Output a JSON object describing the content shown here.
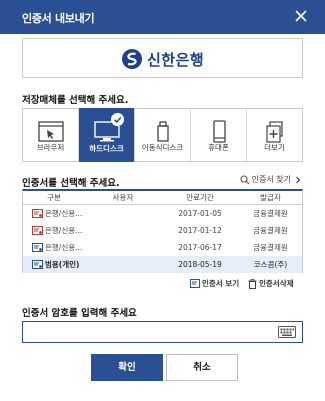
{
  "window": {
    "title": "인증서 내보내기"
  },
  "bank": {
    "name": "신한은행",
    "logo_color": "#1f3f88"
  },
  "media": {
    "heading": "저장매체를 선택해 주세요.",
    "items": [
      {
        "label": "브라우저",
        "icon": "browser-icon",
        "selected": false
      },
      {
        "label": "하드디스크",
        "icon": "hard-disk-icon",
        "selected": true
      },
      {
        "label": "이동식디스크",
        "icon": "removable-disk-icon",
        "selected": false
      },
      {
        "label": "휴대폰",
        "icon": "phone-icon",
        "selected": false
      },
      {
        "label": "더보기",
        "icon": "more-icon",
        "selected": false
      }
    ]
  },
  "certs": {
    "heading": "인증서를 선택해 주세요.",
    "find_label": "인증서 찾기",
    "columns": [
      "구분",
      "사용자",
      "만료기간",
      "발급자"
    ],
    "rows": [
      {
        "type": "은행/신용...",
        "user": "",
        "expiry": "2017-01-05",
        "issuer": "금융결제원",
        "expired": true
      },
      {
        "type": "은행/신용...",
        "user": "",
        "expiry": "2017-01-12",
        "issuer": "금융결제원",
        "expired": true
      },
      {
        "type": "은행/신용...",
        "user": "",
        "expiry": "2017-06-17",
        "issuer": "금융결제원",
        "expired": false
      },
      {
        "type": "범용(개인)",
        "user": "",
        "expiry": "2018-05-19",
        "issuer": "코스콤(주)",
        "expired": false
      }
    ],
    "view_label": "인증서 보기",
    "delete_label": "인증서삭제"
  },
  "password": {
    "heading": "인증서 암호를 입력해 주세요",
    "value": "",
    "placeholder": ""
  },
  "buttons": {
    "ok": "확인",
    "cancel": "취소"
  },
  "colors": {
    "primary": "#2b4f93",
    "highlight_row": "#e8eef9",
    "expired_icon": "#c0392b"
  }
}
